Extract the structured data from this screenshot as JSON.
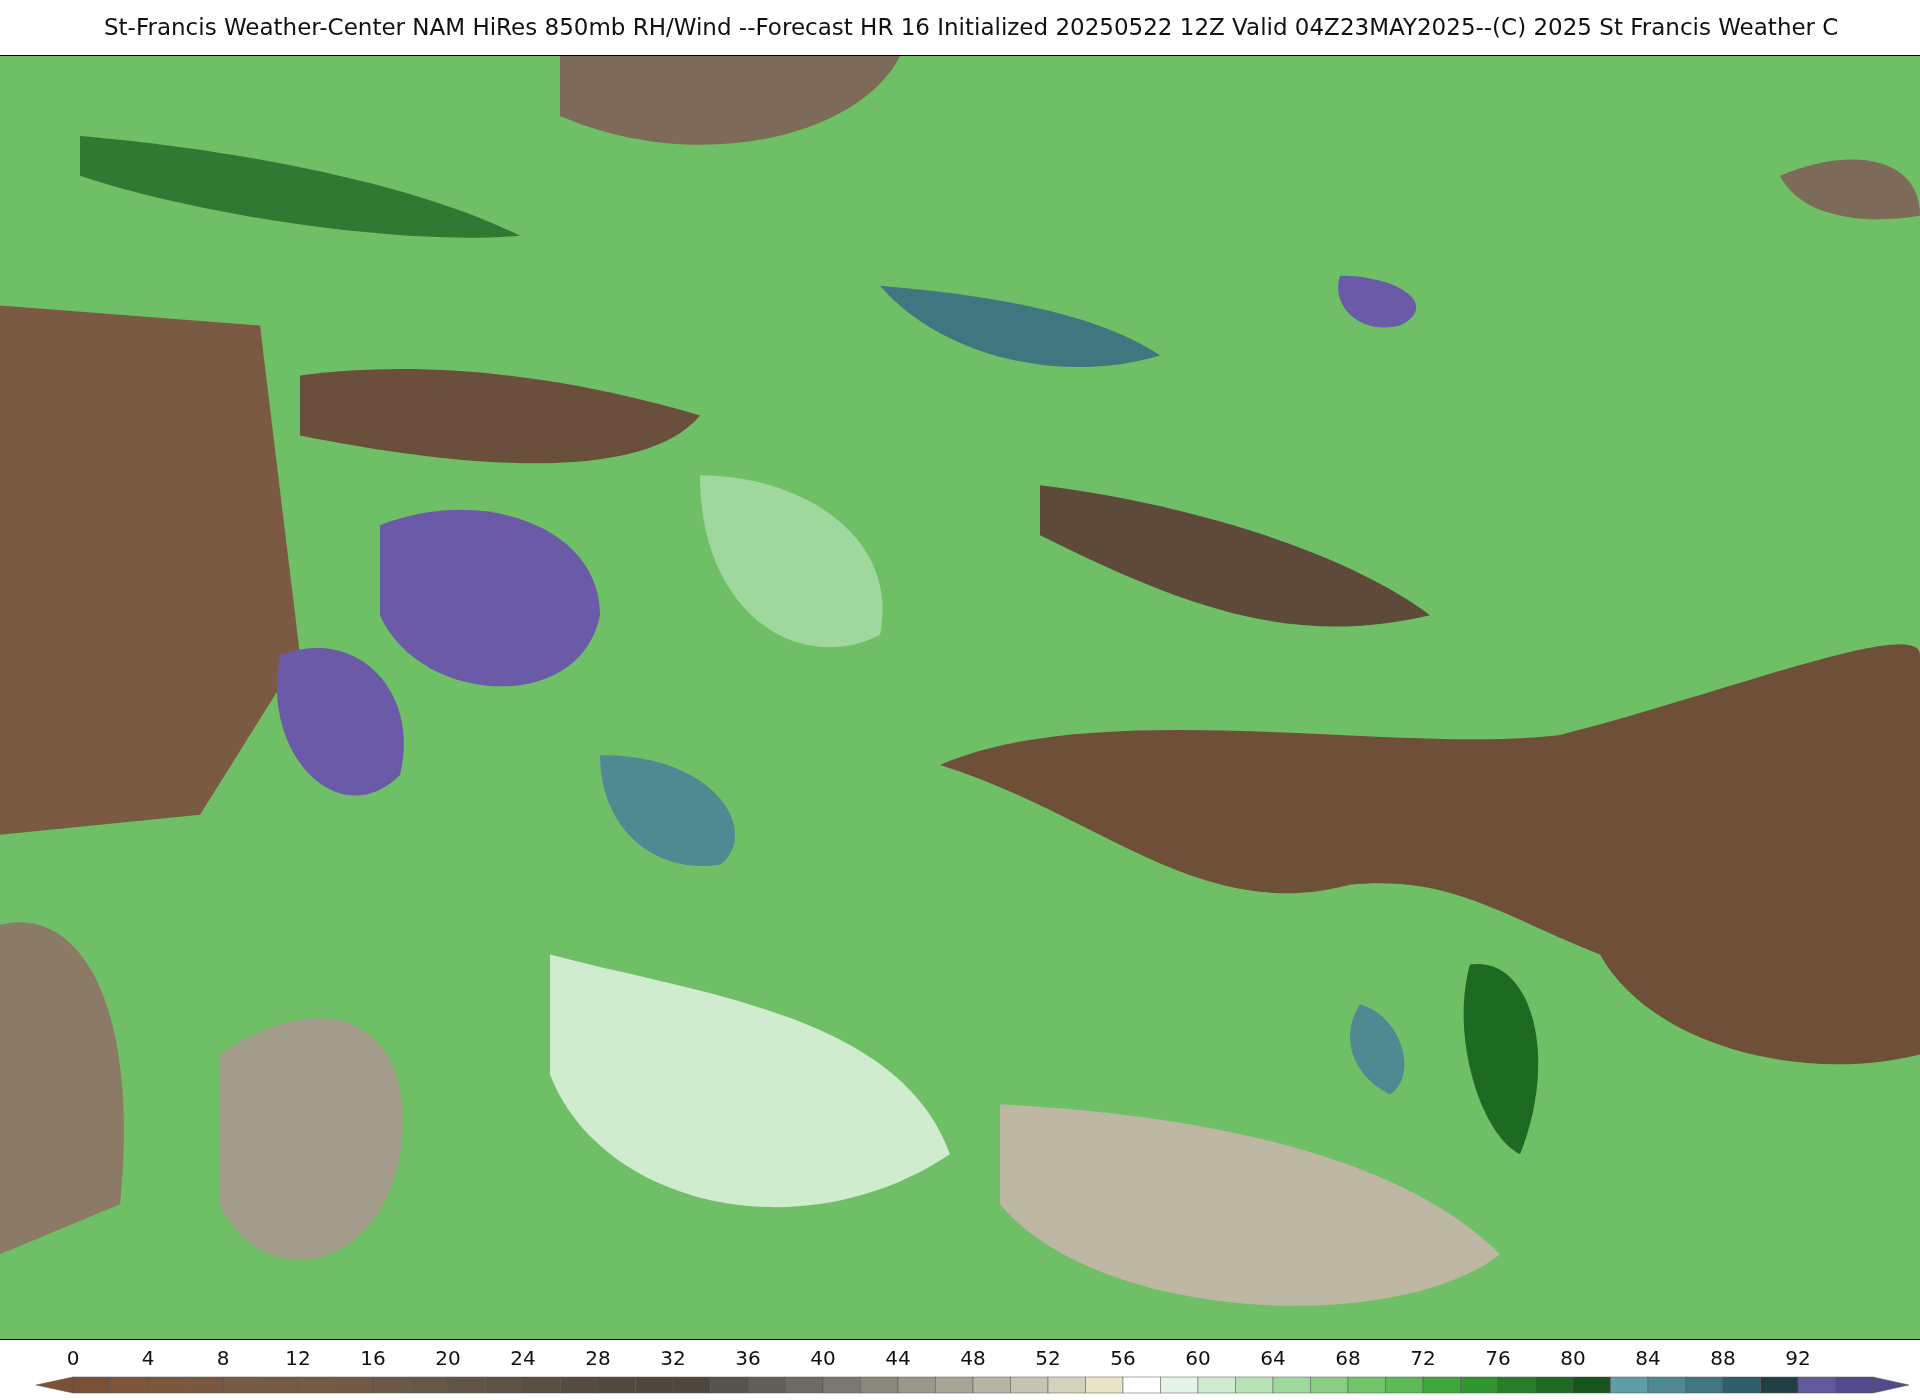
{
  "title": "St-Francis Weather-Center NAM HiRes 850mb RH/Wind  --Forecast HR 16 Initialized 20250522 12Z Valid 04Z23MAY2025--(C) 2025 St Francis Weather C",
  "colorbar": {
    "ticks": [
      "0",
      "4",
      "8",
      "12",
      "16",
      "20",
      "24",
      "28",
      "32",
      "36",
      "40",
      "44",
      "48",
      "52",
      "56",
      "60",
      "64",
      "68",
      "72",
      "76",
      "80",
      "84",
      "88",
      "92"
    ],
    "segments": [
      {
        "color": "#7a5036"
      },
      {
        "color": "#7d5539"
      },
      {
        "color": "#7c573c"
      },
      {
        "color": "#7a583f"
      },
      {
        "color": "#795a42"
      },
      {
        "color": "#765b44"
      },
      {
        "color": "#735b46"
      },
      {
        "color": "#705a47"
      },
      {
        "color": "#6c5947"
      },
      {
        "color": "#685747"
      },
      {
        "color": "#635546"
      },
      {
        "color": "#5e5245"
      },
      {
        "color": "#5a4f43"
      },
      {
        "color": "#554b40"
      },
      {
        "color": "#51483e"
      },
      {
        "color": "#4f473d"
      },
      {
        "color": "#4e473e"
      },
      {
        "color": "#57524a"
      },
      {
        "color": "#625e56"
      },
      {
        "color": "#6f6b62"
      },
      {
        "color": "#7c786f"
      },
      {
        "color": "#8a877c"
      },
      {
        "color": "#99968a"
      },
      {
        "color": "#a8a597"
      },
      {
        "color": "#b7b4a4"
      },
      {
        "color": "#c6c3b1"
      },
      {
        "color": "#d4d1bd"
      },
      {
        "color": "#e8e4c8"
      },
      {
        "color": "#ffffff"
      },
      {
        "color": "#e4f4e4"
      },
      {
        "color": "#cfeccf"
      },
      {
        "color": "#b7e2b6"
      },
      {
        "color": "#9fd89c"
      },
      {
        "color": "#8acd83"
      },
      {
        "color": "#72c46a"
      },
      {
        "color": "#5cba54"
      },
      {
        "color": "#3fa83b"
      },
      {
        "color": "#2f9630"
      },
      {
        "color": "#267f28"
      },
      {
        "color": "#1d6a22"
      },
      {
        "color": "#16551b"
      },
      {
        "color": "#5f9ea6"
      },
      {
        "color": "#4f8a93"
      },
      {
        "color": "#3f7680"
      },
      {
        "color": "#2f5f6a"
      },
      {
        "color": "#1f3f45"
      },
      {
        "color": "#5f5a9c"
      },
      {
        "color": "#504b8a"
      }
    ]
  }
}
